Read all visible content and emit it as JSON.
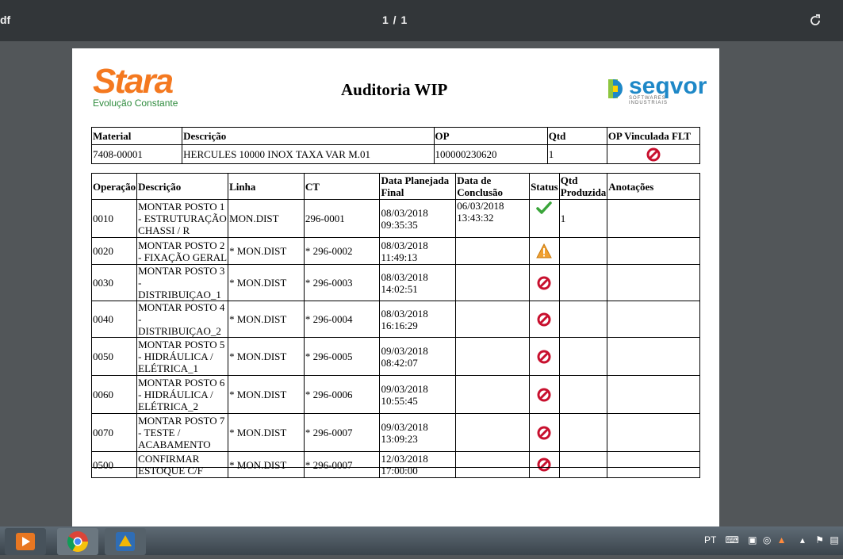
{
  "toolbar": {
    "title": "df",
    "page_indicator": "1 / 1"
  },
  "logos": {
    "stara_word": "Stara",
    "stara_tagline": "Evolução Constante",
    "seqvor_word": "seqvor",
    "seqvor_sub": "SOFTWARES INDUSTRIAIS"
  },
  "document": {
    "title": "Auditoria WIP"
  },
  "header_table": {
    "columns": [
      "Material",
      "Descrição",
      "OP",
      "Qtd",
      "OP Vinculada FLT"
    ],
    "row": {
      "material": "7408-00001",
      "descricao": "HERCULES 10000 INOX TAXA VAR M.01",
      "op": "100000230620",
      "qtd": "1",
      "op_vinculada_icon": "red-forbidden-icon"
    }
  },
  "ops_table": {
    "columns": [
      "Operação",
      "Descrição",
      "Linha",
      "CT",
      "Data Planejada Final",
      "Data de Conclusão",
      "Status",
      "Qtd Produzida",
      "Anotações"
    ],
    "rows": [
      {
        "operacao": "0010",
        "descricao": "MONTAR POSTO 1 - ESTRUTURAÇÃO CHASSI / R",
        "linha": "MON.DIST",
        "ct": "296-0001",
        "planejada": "08/03/2018 09:35:35",
        "conclusao": "06/03/2018 13:43:32",
        "status": "check",
        "qtd": "1",
        "anotacoes": ""
      },
      {
        "operacao": "0020",
        "descricao": "MONTAR POSTO 2 - FIXAÇÃO GERAL",
        "linha": "* MON.DIST",
        "ct": "* 296-0002",
        "planejada": "08/03/2018 11:49:13",
        "conclusao": "",
        "status": "warning",
        "qtd": "",
        "anotacoes": ""
      },
      {
        "operacao": "0030",
        "descricao": "MONTAR POSTO 3 - DISTRIBUIÇAO_1",
        "linha": "* MON.DIST",
        "ct": "* 296-0003",
        "planejada": "08/03/2018 14:02:51",
        "conclusao": "",
        "status": "forbidden",
        "qtd": "",
        "anotacoes": ""
      },
      {
        "operacao": "0040",
        "descricao": "MONTAR POSTO 4 - DISTRIBUIÇAO_2",
        "linha": "* MON.DIST",
        "ct": "* 296-0004",
        "planejada": "08/03/2018 16:16:29",
        "conclusao": "",
        "status": "forbidden",
        "qtd": "",
        "anotacoes": ""
      },
      {
        "operacao": "0050",
        "descricao": "MONTAR POSTO 5 - HIDRÁULICA / ELÉTRICA_1",
        "linha": "* MON.DIST",
        "ct": "* 296-0005",
        "planejada": "09/03/2018 08:42:07",
        "conclusao": "",
        "status": "forbidden",
        "qtd": "",
        "anotacoes": ""
      },
      {
        "operacao": "0060",
        "descricao": "MONTAR POSTO 6 - HIDRÁULICA / ELÉTRICA_2",
        "linha": "* MON.DIST",
        "ct": "* 296-0006",
        "planejada": "09/03/2018 10:55:45",
        "conclusao": "",
        "status": "forbidden",
        "qtd": "",
        "anotacoes": ""
      },
      {
        "operacao": "0070",
        "descricao": "MONTAR POSTO 7 - TESTE / ACABAMENTO",
        "linha": "* MON.DIST",
        "ct": "* 296-0007",
        "planejada": "09/03/2018 13:09:23",
        "conclusao": "",
        "status": "forbidden",
        "qtd": "",
        "anotacoes": ""
      },
      {
        "operacao": "0500",
        "descricao": "CONFIRMAR ESTOQUE C/F",
        "linha": "* MON.DIST",
        "ct": "* 296-0007",
        "planejada": "12/03/2018 17:00:00",
        "conclusao": "",
        "status": "forbidden",
        "qtd": "",
        "anotacoes": ""
      }
    ]
  },
  "taskbar": {
    "language": "PT"
  }
}
